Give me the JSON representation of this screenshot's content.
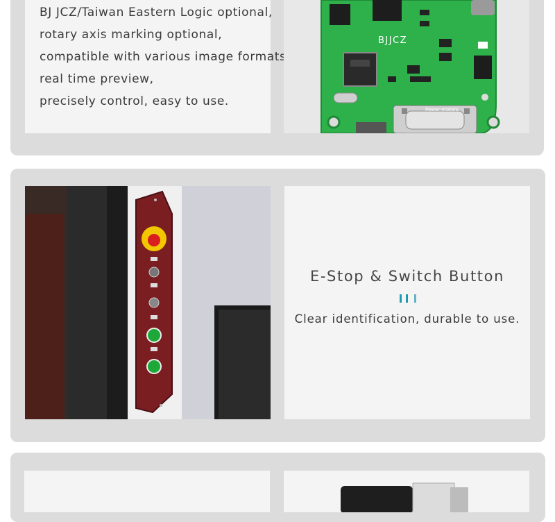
{
  "board_features": {
    "lines": [
      "BJ JCZ/Taiwan Eastern Logic optional,",
      "rotary axis marking optional,",
      "compatible with various image formats,",
      "real time preview,",
      "precisely control, easy to use."
    ],
    "board_labels": {
      "brand": "BJJCZ",
      "connector": "Power-motors"
    }
  },
  "estop_feature": {
    "title": "E-Stop & Switch Button",
    "description": "Clear identification, durable to use.",
    "accent_color": "#1e9ab0",
    "plate_color": "#7a1e22",
    "button_colors": [
      "#d81e1e",
      "#1ea83a"
    ]
  }
}
